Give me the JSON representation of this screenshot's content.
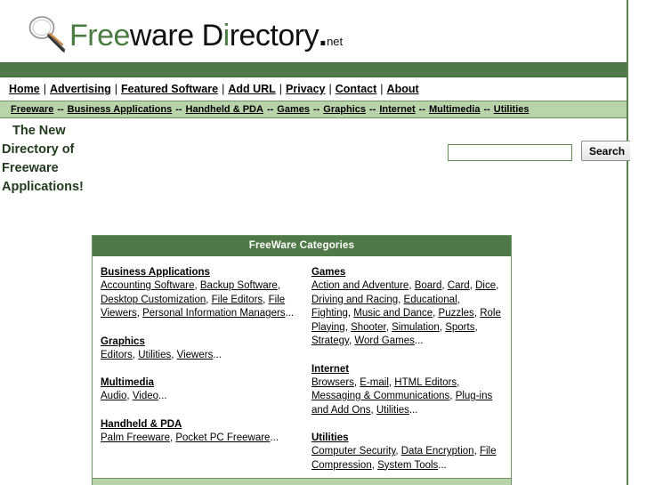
{
  "site": {
    "logo": {
      "icon": "magnifier-icon",
      "part_green_1": "Free",
      "part_black_1": "ware D",
      "part_green_2": "i",
      "part_black_2": "rectory",
      "dot": ".",
      "tld": "net"
    },
    "colors": {
      "dark_green": "#4f7a47",
      "light_green": "#b9d3ab",
      "border_green": "#6f9463",
      "logo_green": "#4a7c42",
      "text": "#000000"
    }
  },
  "nav_main": {
    "items": [
      {
        "label": "Home"
      },
      {
        "label": "Advertising"
      },
      {
        "label": "Featured Software"
      },
      {
        "label": "Add URL"
      },
      {
        "label": "Privacy"
      },
      {
        "label": "Contact"
      },
      {
        "label": "About"
      }
    ],
    "separator": "|"
  },
  "nav_sub": {
    "items": [
      {
        "label": "Freeware"
      },
      {
        "label": "Business Applications"
      },
      {
        "label": "Handheld & PDA"
      },
      {
        "label": "Games"
      },
      {
        "label": "Graphics"
      },
      {
        "label": "Internet"
      },
      {
        "label": "Multimedia"
      },
      {
        "label": "Utilities"
      }
    ],
    "separator": "--"
  },
  "intro": {
    "line1": "The New",
    "line2": "Directory of",
    "line3": "Freeware",
    "line4": "Applications!"
  },
  "search": {
    "value": "",
    "placeholder": "",
    "button_label": "Search"
  },
  "categories_panel": {
    "heading": "FreeWare Categories",
    "left_column": [
      {
        "title": "Business Applications",
        "links": [
          "Accounting Software",
          "Backup Software",
          "Desktop Customization",
          "File Editors",
          "File Viewers",
          "Personal Information Managers"
        ],
        "more": "..."
      },
      {
        "title": "Graphics",
        "links": [
          "Editors",
          "Utilities",
          "Viewers"
        ],
        "more": "..."
      },
      {
        "title": "Multimedia",
        "links": [
          "Audio",
          "Video"
        ],
        "more": "..."
      },
      {
        "title": "Handheld & PDA",
        "links": [
          "Palm Freeware",
          "Pocket PC Freeware"
        ],
        "more": "..."
      }
    ],
    "right_column": [
      {
        "title": "Games",
        "links": [
          "Action and Adventure",
          "Board",
          "Card",
          "Dice",
          "Driving and Racing",
          "Educational",
          "Fighting",
          "Music and Dance",
          "Puzzles",
          "Role Playing",
          "Shooter",
          "Simulation",
          "Sports",
          "Strategy",
          "Word Games"
        ],
        "more": "..."
      },
      {
        "title": "Internet",
        "links": [
          "Browsers",
          "E-mail",
          "HTML Editors",
          "Messaging & Communications",
          "Plug-ins and Add Ons",
          "Utilities"
        ],
        "more": "..."
      },
      {
        "title": "Utilities",
        "links": [
          "Computer Security",
          "Data Encryption",
          "File Compression",
          "System Tools"
        ],
        "more": "..."
      }
    ]
  }
}
